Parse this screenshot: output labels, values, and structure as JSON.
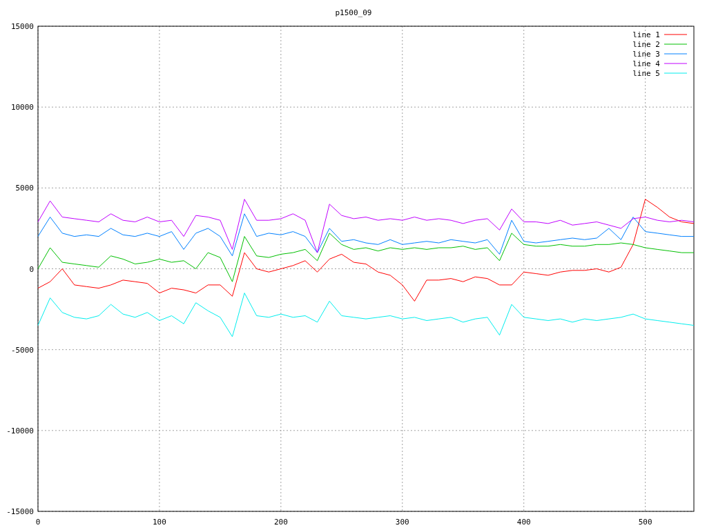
{
  "chart_data": {
    "type": "line",
    "title": "p1500_09",
    "grid": true,
    "legend": true,
    "xlim": [
      0,
      540
    ],
    "ylim": [
      -15000,
      15000
    ],
    "xticks": [
      0,
      100,
      200,
      300,
      400,
      500
    ],
    "yticks": [
      -15000,
      -10000,
      -5000,
      0,
      5000,
      10000,
      15000
    ],
    "x": [
      0,
      10,
      20,
      30,
      40,
      50,
      60,
      70,
      80,
      90,
      100,
      110,
      120,
      130,
      140,
      150,
      160,
      170,
      180,
      190,
      200,
      210,
      220,
      230,
      240,
      250,
      260,
      270,
      280,
      290,
      300,
      310,
      320,
      330,
      340,
      350,
      360,
      370,
      380,
      390,
      400,
      410,
      420,
      430,
      440,
      450,
      460,
      470,
      480,
      490,
      500,
      510,
      520,
      530,
      540
    ],
    "series": [
      {
        "name": "line 1",
        "color": "#ff0000",
        "values": [
          -1200,
          -800,
          0,
          -1000,
          -1100,
          -1200,
          -1000,
          -700,
          -800,
          -900,
          -1500,
          -1200,
          -1300,
          -1500,
          -1000,
          -1000,
          -1700,
          1000,
          0,
          -200,
          0,
          200,
          500,
          -200,
          600,
          900,
          400,
          300,
          -200,
          -400,
          -1000,
          -2000,
          -700,
          -700,
          -600,
          -800,
          -500,
          -600,
          -1000,
          -1000,
          -200,
          -300,
          -400,
          -200,
          -100,
          -100,
          0,
          -200,
          100,
          1500,
          4300,
          3800,
          3200,
          2900,
          2800
        ]
      },
      {
        "name": "line 2",
        "color": "#00c000",
        "values": [
          0,
          1300,
          400,
          300,
          200,
          100,
          800,
          600,
          300,
          400,
          600,
          400,
          500,
          0,
          1000,
          700,
          -800,
          2000,
          800,
          700,
          900,
          1000,
          1200,
          500,
          2200,
          1500,
          1200,
          1300,
          1100,
          1300,
          1200,
          1300,
          1200,
          1300,
          1300,
          1400,
          1200,
          1300,
          500,
          2200,
          1500,
          1400,
          1400,
          1500,
          1400,
          1400,
          1500,
          1500,
          1600,
          1500,
          1300,
          1200,
          1100,
          1000,
          1000
        ]
      },
      {
        "name": "line 3",
        "color": "#0080ff",
        "values": [
          2000,
          3200,
          2200,
          2000,
          2100,
          2000,
          2500,
          2100,
          2000,
          2200,
          2000,
          2300,
          1200,
          2200,
          2500,
          2000,
          800,
          3400,
          2000,
          2200,
          2100,
          2300,
          2000,
          1000,
          2500,
          1700,
          1800,
          1600,
          1500,
          1800,
          1500,
          1600,
          1700,
          1600,
          1800,
          1700,
          1600,
          1800,
          900,
          3000,
          1700,
          1600,
          1700,
          1800,
          1900,
          1800,
          1900,
          2500,
          1800,
          3200,
          2300,
          2200,
          2100,
          2000,
          2000
        ]
      },
      {
        "name": "line 4",
        "color": "#c000ff",
        "values": [
          2900,
          4200,
          3200,
          3100,
          3000,
          2900,
          3400,
          3000,
          2900,
          3200,
          2900,
          3000,
          2000,
          3300,
          3200,
          3000,
          1200,
          4300,
          3000,
          3000,
          3100,
          3400,
          3000,
          1000,
          4000,
          3300,
          3100,
          3200,
          3000,
          3100,
          3000,
          3200,
          3000,
          3100,
          3000,
          2800,
          3000,
          3100,
          2400,
          3700,
          2900,
          2900,
          2800,
          3000,
          2700,
          2800,
          2900,
          2700,
          2500,
          3100,
          3200,
          3000,
          2900,
          3000,
          2900
        ]
      },
      {
        "name": "line 5",
        "color": "#00eeee",
        "values": [
          -3500,
          -1800,
          -2700,
          -3000,
          -3100,
          -2900,
          -2200,
          -2800,
          -3000,
          -2700,
          -3200,
          -2900,
          -3400,
          -2100,
          -2600,
          -3000,
          -4200,
          -1500,
          -2900,
          -3000,
          -2800,
          -3000,
          -2900,
          -3300,
          -2000,
          -2900,
          -3000,
          -3100,
          -3000,
          -2900,
          -3100,
          -3000,
          -3200,
          -3100,
          -3000,
          -3300,
          -3100,
          -3000,
          -4100,
          -2200,
          -3000,
          -3100,
          -3200,
          -3100,
          -3300,
          -3100,
          -3200,
          -3100,
          -3000,
          -2800,
          -3100,
          -3200,
          -3300,
          -3400,
          -3500
        ]
      }
    ]
  }
}
